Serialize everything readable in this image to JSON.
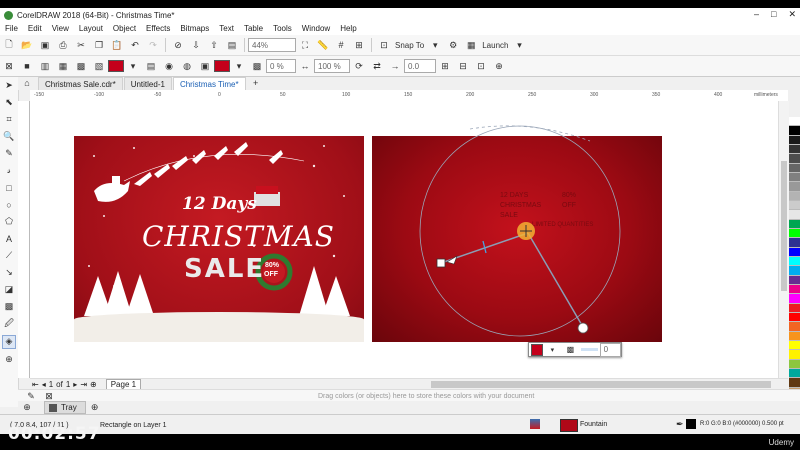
{
  "window": {
    "title": "CorelDRAW 2018 (64-Bit) - Christmas Time*",
    "controls": [
      "–",
      "□",
      "✕"
    ]
  },
  "menu": [
    "File",
    "Edit",
    "View",
    "Layout",
    "Object",
    "Effects",
    "Bitmaps",
    "Text",
    "Table",
    "Tools",
    "Window",
    "Help"
  ],
  "toolbar": {
    "zoom": "44%",
    "snap_to": "Snap To",
    "launch": "Launch"
  },
  "propertybar": {
    "fill_percent": "0 %",
    "scale_percent": "100 %",
    "angle": "0.0"
  },
  "tabs": [
    "Christmas Sale.cdr*",
    "Untitled-1",
    "Christmas Time*"
  ],
  "active_tab": 2,
  "ruler": {
    "ticks": [
      "-150",
      "-100",
      "-50",
      "0",
      "50",
      "100",
      "150",
      "200",
      "250",
      "300",
      "350",
      "400"
    ],
    "unit": "millimeters"
  },
  "artwork": {
    "headline_top": "12 Days",
    "headline_main": "CHRISTMAS",
    "headline_sale": "SALE",
    "badge_top": "80%",
    "badge_bottom": "OFF"
  },
  "page_text": {
    "line1": "12 DAYS",
    "line1_right": "80%",
    "line2": "CHRISTMAS",
    "line2_right": "OFF",
    "line3": "SALE",
    "line4": "LIMITED QUANTITIES"
  },
  "fill_widget": {
    "value": "0"
  },
  "pager": {
    "current": "1",
    "of": "of",
    "total": "1",
    "page_tab": "Page 1"
  },
  "color_dock": {
    "hint": "Drag colors (or objects) here to store these colors with your document"
  },
  "tray": {
    "label": "Tray"
  },
  "status": {
    "coords": "( 7.0 8.4, 107 / 11 )",
    "object": "Rectangle on Layer 1",
    "fill_label": "Fountain",
    "outline_value": "R:0 G:0 B:0 (#000000)  0.500 pt"
  },
  "overlay": {
    "timer": "00:02:57",
    "watermark": "Udemy"
  },
  "palette_colors": [
    "#ffffff",
    "#000000",
    "#1a1a1a",
    "#333333",
    "#4d4d4d",
    "#666666",
    "#808080",
    "#999999",
    "#b3b3b3",
    "#cccccc",
    "#e6e6e6",
    "#00a651",
    "#00ff00",
    "#2e3192",
    "#0000ff",
    "#00ffff",
    "#00aeef",
    "#662d91",
    "#ec008c",
    "#ff00ff",
    "#ed1c24",
    "#ff0000",
    "#f26522",
    "#f7941d",
    "#ffff00",
    "#fff200",
    "#8dc63f",
    "#00a99d",
    "#603913",
    "#c69c6d"
  ]
}
